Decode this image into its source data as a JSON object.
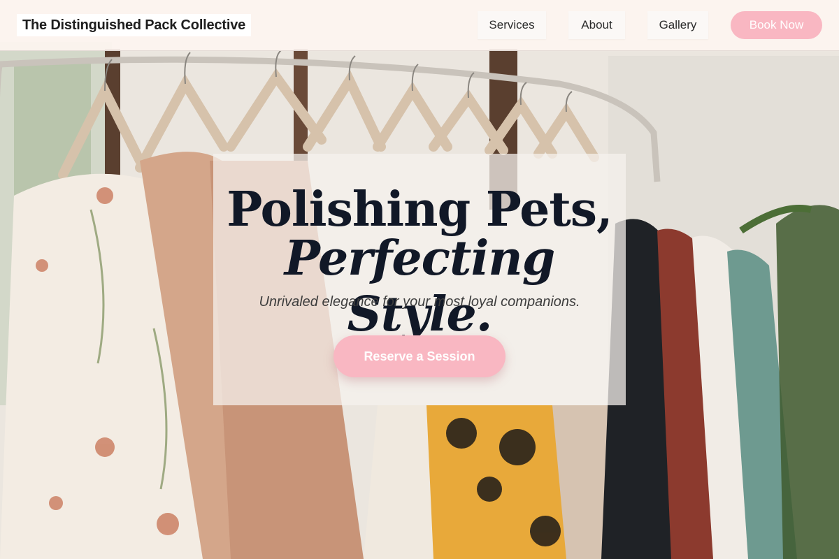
{
  "header": {
    "brand": "The Distinguished Pack Collective",
    "nav": [
      {
        "label": "Services"
      },
      {
        "label": "About"
      },
      {
        "label": "Gallery"
      }
    ],
    "book_label": "Book Now"
  },
  "hero": {
    "headline_line1": "Polishing Pets,",
    "headline_line2": "Perfecting Style.",
    "subheadline": "Unrivaled elegance for your most loyal companions.",
    "cta_label": "Reserve a Session",
    "background_image": "clothing-rack-photo"
  },
  "colors": {
    "accent_pink": "#f9b7c2",
    "header_bg": "#fdf4f0",
    "headline_text": "#111827"
  }
}
